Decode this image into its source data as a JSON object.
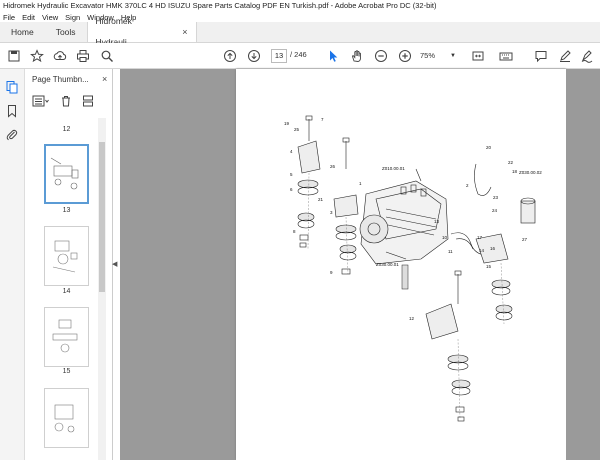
{
  "window": {
    "title": "Hidromek Hydraulic Excavator HMK 370LC 4 HD ISUZU Spare Parts Catalog PDF EN Turkish.pdf - Adobe Acrobat Pro DC (32-bit)"
  },
  "menu": [
    "File",
    "Edit",
    "View",
    "Sign",
    "Window",
    "Help"
  ],
  "tabs": {
    "home": "Home",
    "tools": "Tools",
    "document": "Hidromek Hydrauli...",
    "close": "×"
  },
  "toolbar": {
    "current_page": "13",
    "total_pages": "/ 246",
    "zoom": "75%"
  },
  "thumbnails": {
    "title": "Page Thumbn...",
    "close": "×",
    "pages": [
      "12",
      "13",
      "14",
      "15"
    ]
  },
  "diagram": {
    "labels": [
      "Z010.00.01",
      "Z030.00.01",
      "Z030.00.02"
    ],
    "callouts": [
      "7",
      "19",
      "25",
      "4",
      "26",
      "5",
      "6",
      "1",
      "21",
      "3",
      "8",
      "9",
      "2",
      "23",
      "20",
      "22",
      "18",
      "24",
      "13",
      "27",
      "10",
      "11",
      "14",
      "15",
      "16",
      "17",
      "12"
    ]
  },
  "colors": {
    "accent": "#1a73e8",
    "viewer_bg": "#9a9a9a",
    "selected_border": "#5b9bd5"
  }
}
